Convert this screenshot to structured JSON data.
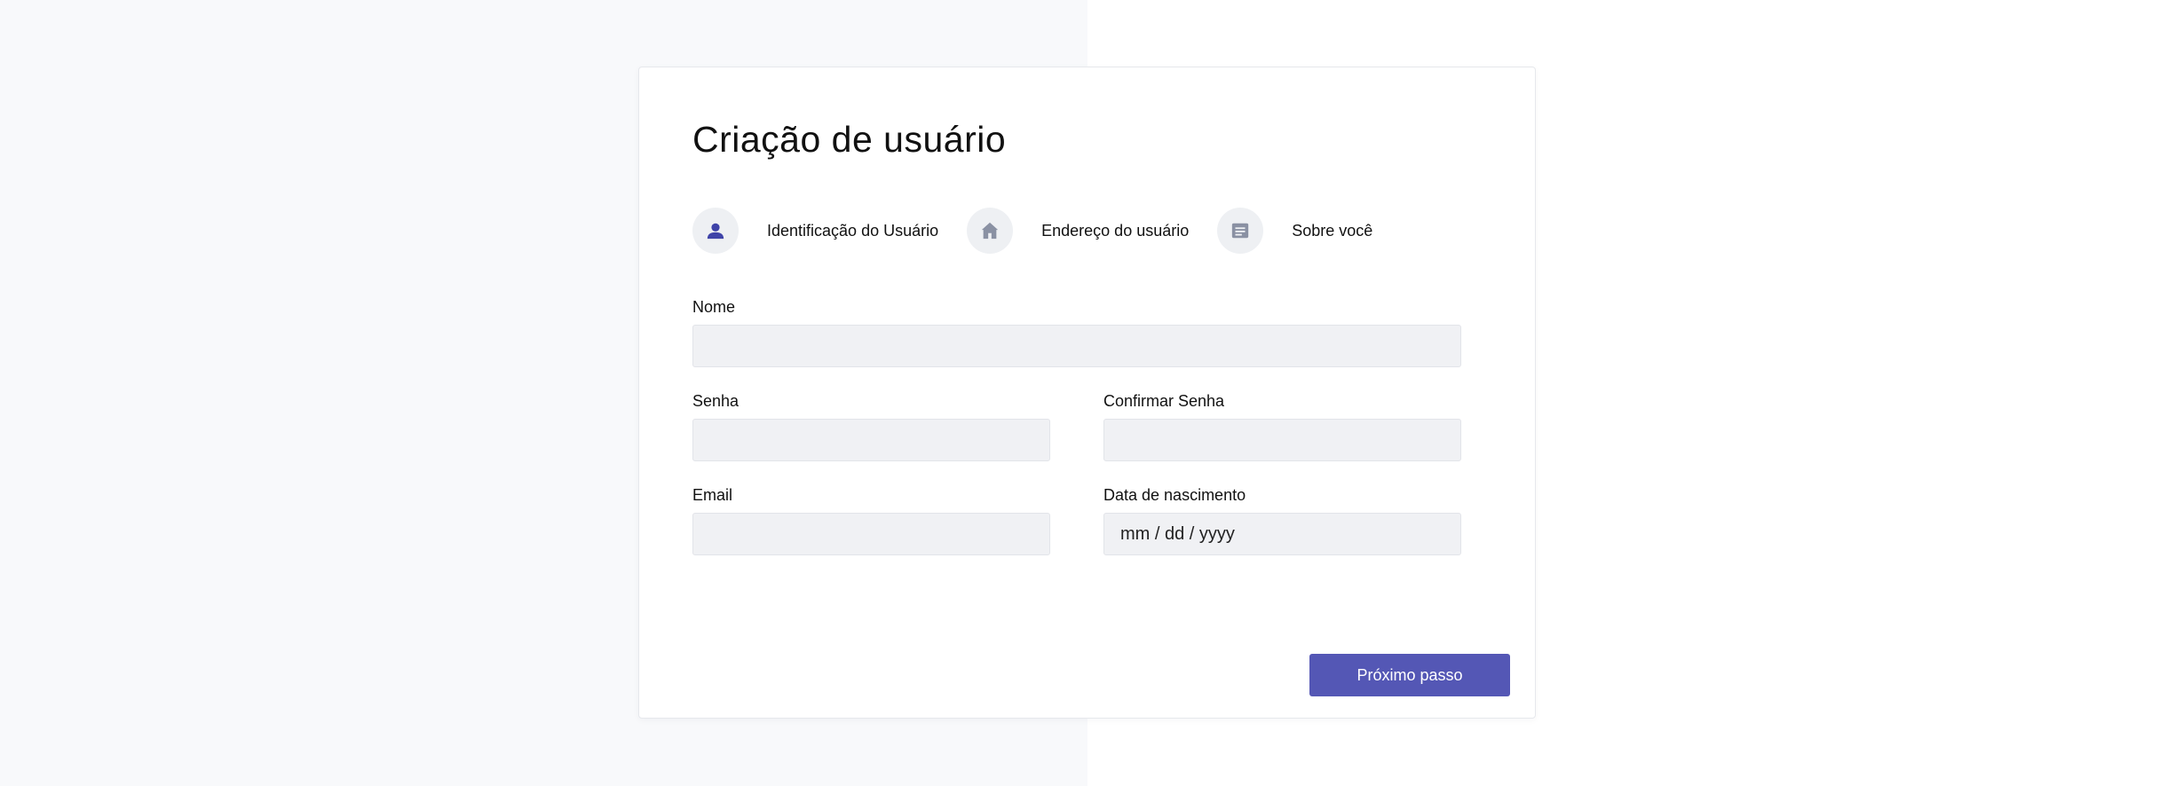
{
  "page": {
    "title": "Criação de usuário"
  },
  "steps": [
    {
      "label": "Identificação do Usuário",
      "icon": "user-icon",
      "active": true
    },
    {
      "label": "Endereço do usuário",
      "icon": "home-icon",
      "active": false
    },
    {
      "label": "Sobre você",
      "icon": "message-icon",
      "active": false
    }
  ],
  "form": {
    "nome": {
      "label": "Nome",
      "value": "",
      "placeholder": ""
    },
    "senha": {
      "label": "Senha",
      "value": "",
      "placeholder": ""
    },
    "confirmar_senha": {
      "label": "Confirmar Senha",
      "value": "",
      "placeholder": ""
    },
    "email": {
      "label": "Email",
      "value": "",
      "placeholder": ""
    },
    "data_nascimento": {
      "label": "Data de nascimento",
      "value": "",
      "placeholder": "mm / dd / yyyy"
    }
  },
  "actions": {
    "next_label": "Próximo passo"
  },
  "colors": {
    "accent": "#5457b5",
    "active_icon": "#3f43a8",
    "inactive_icon": "#8a91a3",
    "input_bg": "#f0f1f4",
    "page_bg_left": "#f8f9fb"
  }
}
